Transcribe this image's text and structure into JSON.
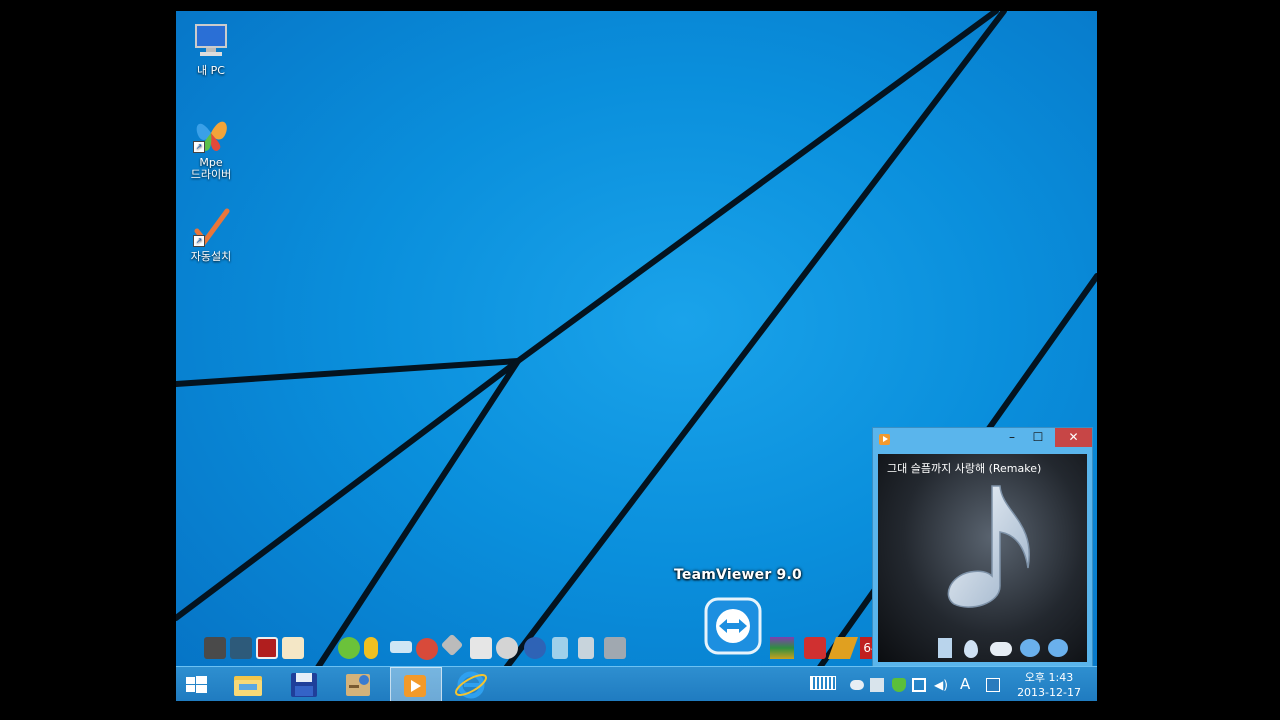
{
  "desktop": {
    "icons": [
      {
        "label_line1": "내 PC",
        "label_line2": "",
        "icon": "computer-icon"
      },
      {
        "label_line1": "Mpe",
        "label_line2": "드라이버",
        "icon": "butterfly-icon"
      },
      {
        "label_line1": "자동설치",
        "label_line2": "",
        "icon": "checkmark-icon"
      }
    ],
    "teamviewer_label": "TeamViewer 9.0"
  },
  "player_window": {
    "song_title": "그대 슬픔까지 사랑해 (Remake)",
    "min_glyph": "–",
    "max_glyph": "☐",
    "close_glyph": "✕",
    "art_icon": "music-note-icon"
  },
  "taskbar": {
    "buttons": [
      "start-button",
      "file-explorer",
      "save-app",
      "tools-app",
      "media-player",
      "internet-explorer"
    ],
    "tray": {
      "ime_label": "A",
      "time": "오후 1:43",
      "date": "2013-12-17"
    }
  },
  "colors": {
    "wallpaper": "#0a8fdc",
    "taskbar": "#2384c6",
    "close_button": "#c74646",
    "window_frame": "#5ab5ec"
  }
}
